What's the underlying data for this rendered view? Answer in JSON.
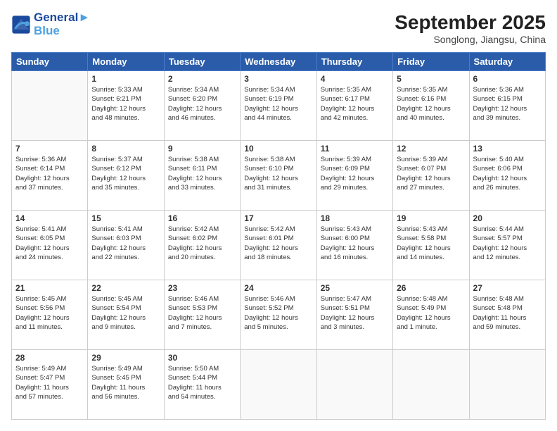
{
  "header": {
    "logo_line1": "General",
    "logo_line2": "Blue",
    "month": "September 2025",
    "location": "Songlong, Jiangsu, China"
  },
  "weekdays": [
    "Sunday",
    "Monday",
    "Tuesday",
    "Wednesday",
    "Thursday",
    "Friday",
    "Saturday"
  ],
  "weeks": [
    [
      {
        "day": "",
        "info": ""
      },
      {
        "day": "1",
        "info": "Sunrise: 5:33 AM\nSunset: 6:21 PM\nDaylight: 12 hours\nand 48 minutes."
      },
      {
        "day": "2",
        "info": "Sunrise: 5:34 AM\nSunset: 6:20 PM\nDaylight: 12 hours\nand 46 minutes."
      },
      {
        "day": "3",
        "info": "Sunrise: 5:34 AM\nSunset: 6:19 PM\nDaylight: 12 hours\nand 44 minutes."
      },
      {
        "day": "4",
        "info": "Sunrise: 5:35 AM\nSunset: 6:17 PM\nDaylight: 12 hours\nand 42 minutes."
      },
      {
        "day": "5",
        "info": "Sunrise: 5:35 AM\nSunset: 6:16 PM\nDaylight: 12 hours\nand 40 minutes."
      },
      {
        "day": "6",
        "info": "Sunrise: 5:36 AM\nSunset: 6:15 PM\nDaylight: 12 hours\nand 39 minutes."
      }
    ],
    [
      {
        "day": "7",
        "info": "Sunrise: 5:36 AM\nSunset: 6:14 PM\nDaylight: 12 hours\nand 37 minutes."
      },
      {
        "day": "8",
        "info": "Sunrise: 5:37 AM\nSunset: 6:12 PM\nDaylight: 12 hours\nand 35 minutes."
      },
      {
        "day": "9",
        "info": "Sunrise: 5:38 AM\nSunset: 6:11 PM\nDaylight: 12 hours\nand 33 minutes."
      },
      {
        "day": "10",
        "info": "Sunrise: 5:38 AM\nSunset: 6:10 PM\nDaylight: 12 hours\nand 31 minutes."
      },
      {
        "day": "11",
        "info": "Sunrise: 5:39 AM\nSunset: 6:09 PM\nDaylight: 12 hours\nand 29 minutes."
      },
      {
        "day": "12",
        "info": "Sunrise: 5:39 AM\nSunset: 6:07 PM\nDaylight: 12 hours\nand 27 minutes."
      },
      {
        "day": "13",
        "info": "Sunrise: 5:40 AM\nSunset: 6:06 PM\nDaylight: 12 hours\nand 26 minutes."
      }
    ],
    [
      {
        "day": "14",
        "info": "Sunrise: 5:41 AM\nSunset: 6:05 PM\nDaylight: 12 hours\nand 24 minutes."
      },
      {
        "day": "15",
        "info": "Sunrise: 5:41 AM\nSunset: 6:03 PM\nDaylight: 12 hours\nand 22 minutes."
      },
      {
        "day": "16",
        "info": "Sunrise: 5:42 AM\nSunset: 6:02 PM\nDaylight: 12 hours\nand 20 minutes."
      },
      {
        "day": "17",
        "info": "Sunrise: 5:42 AM\nSunset: 6:01 PM\nDaylight: 12 hours\nand 18 minutes."
      },
      {
        "day": "18",
        "info": "Sunrise: 5:43 AM\nSunset: 6:00 PM\nDaylight: 12 hours\nand 16 minutes."
      },
      {
        "day": "19",
        "info": "Sunrise: 5:43 AM\nSunset: 5:58 PM\nDaylight: 12 hours\nand 14 minutes."
      },
      {
        "day": "20",
        "info": "Sunrise: 5:44 AM\nSunset: 5:57 PM\nDaylight: 12 hours\nand 12 minutes."
      }
    ],
    [
      {
        "day": "21",
        "info": "Sunrise: 5:45 AM\nSunset: 5:56 PM\nDaylight: 12 hours\nand 11 minutes."
      },
      {
        "day": "22",
        "info": "Sunrise: 5:45 AM\nSunset: 5:54 PM\nDaylight: 12 hours\nand 9 minutes."
      },
      {
        "day": "23",
        "info": "Sunrise: 5:46 AM\nSunset: 5:53 PM\nDaylight: 12 hours\nand 7 minutes."
      },
      {
        "day": "24",
        "info": "Sunrise: 5:46 AM\nSunset: 5:52 PM\nDaylight: 12 hours\nand 5 minutes."
      },
      {
        "day": "25",
        "info": "Sunrise: 5:47 AM\nSunset: 5:51 PM\nDaylight: 12 hours\nand 3 minutes."
      },
      {
        "day": "26",
        "info": "Sunrise: 5:48 AM\nSunset: 5:49 PM\nDaylight: 12 hours\nand 1 minute."
      },
      {
        "day": "27",
        "info": "Sunrise: 5:48 AM\nSunset: 5:48 PM\nDaylight: 11 hours\nand 59 minutes."
      }
    ],
    [
      {
        "day": "28",
        "info": "Sunrise: 5:49 AM\nSunset: 5:47 PM\nDaylight: 11 hours\nand 57 minutes."
      },
      {
        "day": "29",
        "info": "Sunrise: 5:49 AM\nSunset: 5:45 PM\nDaylight: 11 hours\nand 56 minutes."
      },
      {
        "day": "30",
        "info": "Sunrise: 5:50 AM\nSunset: 5:44 PM\nDaylight: 11 hours\nand 54 minutes."
      },
      {
        "day": "",
        "info": ""
      },
      {
        "day": "",
        "info": ""
      },
      {
        "day": "",
        "info": ""
      },
      {
        "day": "",
        "info": ""
      }
    ]
  ]
}
